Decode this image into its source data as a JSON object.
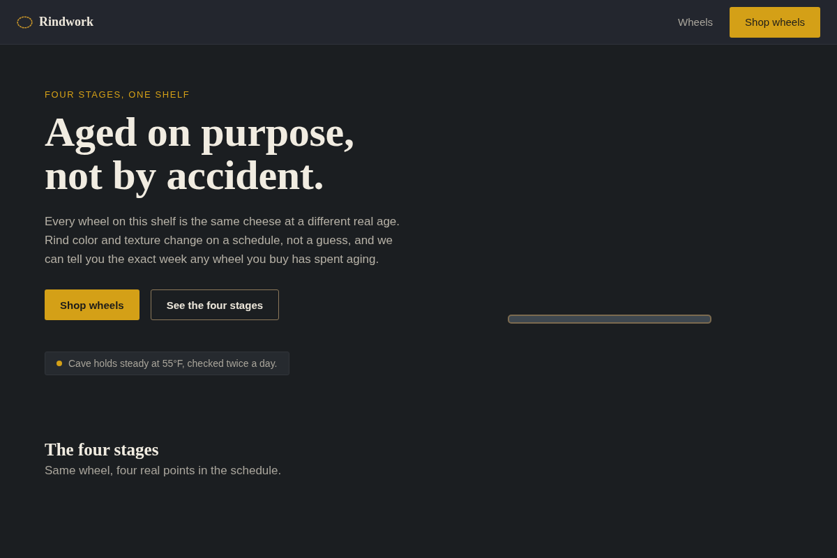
{
  "header": {
    "brand": "Rindwork",
    "nav": [
      {
        "label": "Wheels"
      }
    ],
    "cta": "Shop wheels"
  },
  "hero": {
    "eyebrow": "FOUR STAGES, ONE SHELF",
    "headline": "Aged on purpose, not by accident.",
    "body": "Every wheel on this shelf is the same cheese at a different real age. Rind color and texture change on a schedule, not a guess, and we can tell you the exact week any wheel you buy has spent aging.",
    "buttons": [
      {
        "label": "Shop wheels",
        "kind": "primary"
      },
      {
        "label": "See the four stages",
        "kind": "secondary"
      }
    ],
    "note": "Cave holds steady at 55°F, checked twice a day."
  },
  "stages": {
    "title": "The four stages",
    "subtitle": "Same wheel, four real points in the schedule."
  }
}
